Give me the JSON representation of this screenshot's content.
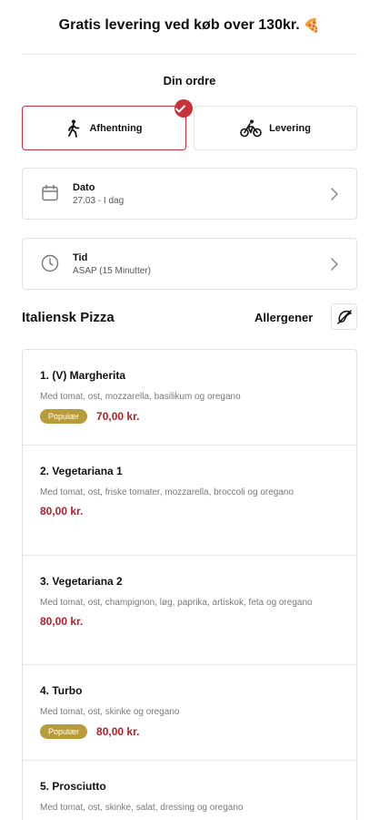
{
  "banner": {
    "text": "Gratis levering ved køb over 130kr.",
    "emoji": "🍕"
  },
  "order": {
    "title": "Din ordre",
    "pickup_label": "Afhentning",
    "delivery_label": "Levering",
    "selected": "pickup"
  },
  "date_card": {
    "label": "Dato",
    "value": "27.03 - I dag"
  },
  "time_card": {
    "label": "Tid",
    "value": "ASAP (15 Minutter)"
  },
  "category": {
    "title": "Italiensk Pizza",
    "allergen_label": "Allergener"
  },
  "items": [
    {
      "name": "1. (V) Margherita",
      "desc": "Med tomat, ost, mozzarella, basilikum og oregano",
      "badge": "Populær",
      "price": "70,00 kr."
    },
    {
      "name": "2. Vegetariana 1",
      "desc": "Med tomat, ost, friske tomater, mozzarella, broccoli og oregano",
      "price": "80,00 kr."
    },
    {
      "name": "3. Vegetariana 2",
      "desc": "Med tomat, ost, champignon, løg, paprika, artiskok, feta og oregano",
      "price": "80,00 kr."
    },
    {
      "name": "4. Turbo",
      "desc": "Med tomat, ost, skinke og oregano",
      "badge": "Populær",
      "price": "80,00 kr."
    },
    {
      "name": "5. Prosciutto",
      "desc": "Med tomat, ost, skinke, salat, dressing og oregano"
    }
  ],
  "colors": {
    "accent": "#c8333b",
    "price": "#b0202a",
    "badge": "#b89b3a"
  }
}
